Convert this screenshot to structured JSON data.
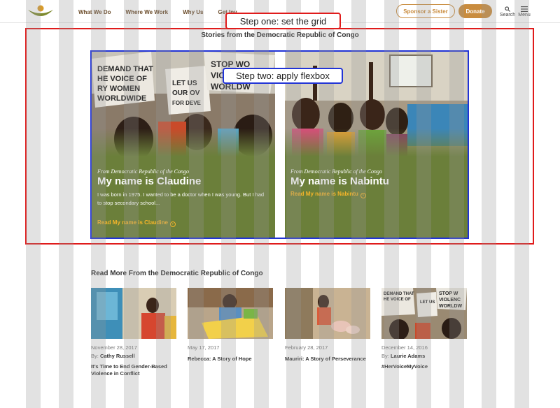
{
  "header": {
    "nav": [
      "What We Do",
      "Where We Work",
      "Why Us",
      "Get Inv"
    ],
    "sponsor_label": "Sponsor a Sister",
    "donate_label": "Donate",
    "search_label": "Search",
    "menu_label": "Menu"
  },
  "annotations": {
    "step_one": "Step one: set the grid",
    "step_two": "Step two: apply flexbox"
  },
  "stories": {
    "title": "Stories from the Democratic Republic of Congo",
    "cards": [
      {
        "from": "From Democratic Republic of the Congo",
        "name": "My name is Claudine",
        "excerpt": "I was born in 1975. I wanted to be a doctor when I was young. But I had to stop secondary school...",
        "read_label": "Read My name is Claudine"
      },
      {
        "from": "From Democratic Republic of the Congo",
        "name": "My name is Nabintu",
        "read_label": "Read My name is Nabintu"
      }
    ]
  },
  "read_more": {
    "title": "Read More From the Democratic Republic of Congo",
    "articles": [
      {
        "date": "November 28, 2017",
        "by": "By:",
        "author": "Cathy Russell",
        "title": "It’s Time to End Gender-Based Violence in Conflict"
      },
      {
        "date": "May 17, 2017",
        "title": "Rebecca: A Story of Hope"
      },
      {
        "date": "February 28, 2017",
        "title": "Mauriri: A Story of Perseverance"
      },
      {
        "date": "December 14, 2016",
        "by": "By:",
        "author": "Laurie Adams",
        "title": "#HerVoiceMyVoice"
      }
    ]
  },
  "colors": {
    "accent": "#c98c3e",
    "card_green": "#6b7f3a",
    "link_yellow": "#f5b52a",
    "annotation_red": "#e01b1b",
    "annotation_blue": "#2133d6"
  }
}
